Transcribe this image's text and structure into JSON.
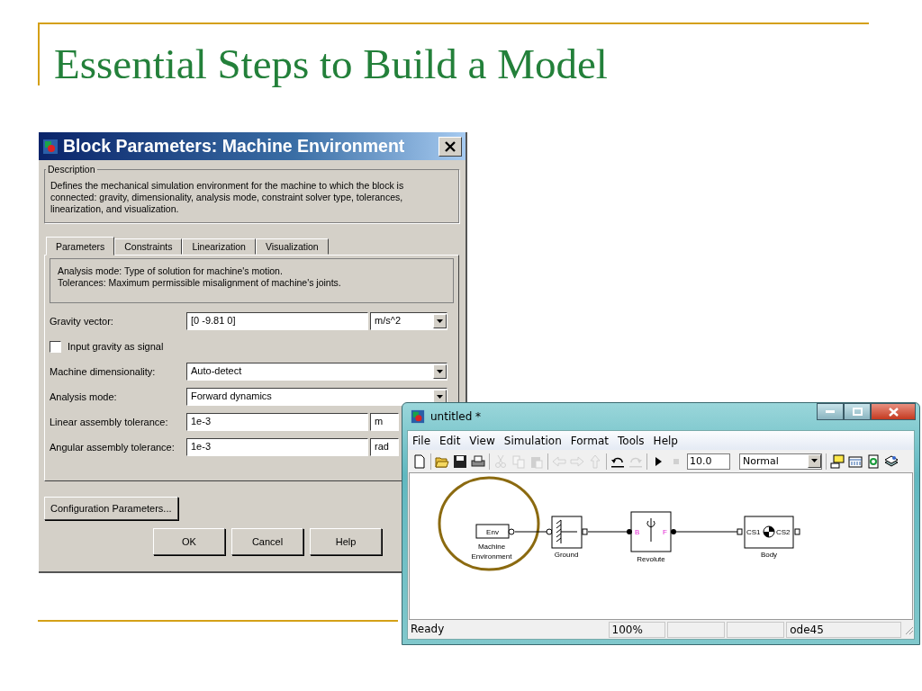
{
  "slide": {
    "title": "Essential Steps to Build a Model"
  },
  "dialog": {
    "title": "Block Parameters: Machine Environment",
    "description_legend": "Description",
    "description": "Defines the mechanical simulation environment for the machine to which the block is connected: gravity, dimensionality, analysis mode, constraint solver type, tolerances, linearization, and visualization.",
    "tabs": [
      {
        "label": "Parameters",
        "selected": true
      },
      {
        "label": "Constraints",
        "selected": false
      },
      {
        "label": "Linearization",
        "selected": false
      },
      {
        "label": "Visualization",
        "selected": false
      }
    ],
    "help_lines": [
      "Analysis mode: Type of solution for machine's motion.",
      "Tolerances: Maximum permissible misalignment of machine's joints."
    ],
    "params": [
      {
        "kind": "field",
        "label": "Gravity vector:",
        "value": "[0 -9.81 0]",
        "unit": "m/s^2"
      },
      {
        "kind": "checkbox",
        "label": "Input gravity as signal",
        "checked": false
      },
      {
        "kind": "dropdown",
        "label": "Machine dimensionality:",
        "value": "Auto-detect"
      },
      {
        "kind": "dropdown",
        "label": "Analysis mode:",
        "value": "Forward dynamics"
      },
      {
        "kind": "field",
        "label": "Linear assembly tolerance:",
        "value": "1e-3",
        "unit": "m"
      },
      {
        "kind": "field",
        "label": "Angular assembly tolerance:",
        "value": "1e-3",
        "unit": "rad"
      }
    ],
    "config_button": "Configuration Parameters...",
    "buttons": [
      "OK",
      "Cancel",
      "Help"
    ]
  },
  "model_window": {
    "title": "untitled *",
    "menu": [
      "File",
      "Edit",
      "View",
      "Simulation",
      "Format",
      "Tools",
      "Help"
    ],
    "toolbar": [
      {
        "kind": "new",
        "disabled": false
      },
      {
        "kind": "sep"
      },
      {
        "kind": "open",
        "disabled": false
      },
      {
        "kind": "save",
        "disabled": false
      },
      {
        "kind": "print",
        "disabled": false
      },
      {
        "kind": "sep"
      },
      {
        "kind": "cut",
        "disabled": true
      },
      {
        "kind": "copy",
        "disabled": true
      },
      {
        "kind": "paste",
        "disabled": true
      },
      {
        "kind": "sep"
      },
      {
        "kind": "back",
        "disabled": true
      },
      {
        "kind": "forward",
        "disabled": true
      },
      {
        "kind": "up",
        "disabled": true
      },
      {
        "kind": "sep"
      },
      {
        "kind": "undo",
        "disabled": false
      },
      {
        "kind": "redo",
        "disabled": true
      },
      {
        "kind": "sep"
      },
      {
        "kind": "play",
        "disabled": false
      },
      {
        "kind": "stop",
        "disabled": true
      }
    ],
    "stop_time": "10.0",
    "sim_mode": "Normal",
    "toolbar_right": [
      {
        "kind": "scope"
      },
      {
        "kind": "library"
      },
      {
        "kind": "refresh"
      },
      {
        "kind": "layers"
      }
    ],
    "blocks": [
      {
        "kind": "env",
        "text": "Env",
        "label": "Machine Environment"
      },
      {
        "kind": "ground",
        "label": "Ground"
      },
      {
        "kind": "revolute",
        "ports": [
          "B",
          "F"
        ],
        "label": "Revolute"
      },
      {
        "kind": "body",
        "ports": [
          "CS1",
          "CS2"
        ],
        "label": "Body"
      }
    ],
    "status_bar": {
      "message": "Ready",
      "zoom": "100%",
      "solver": "ode45"
    }
  }
}
